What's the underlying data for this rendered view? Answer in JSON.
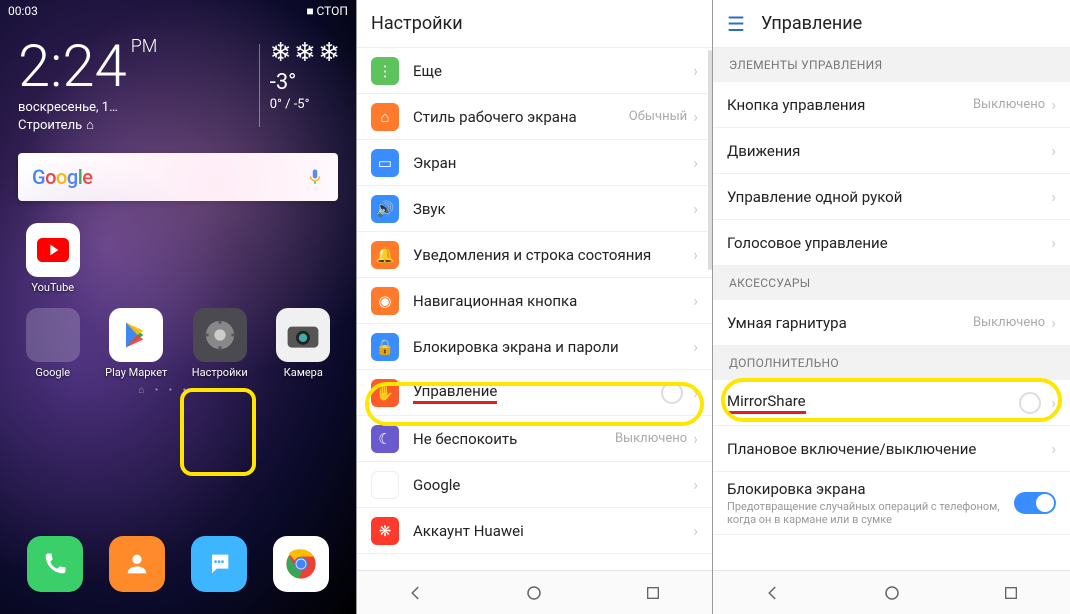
{
  "panel1": {
    "statusbar": {
      "time": "00:03",
      "stop_label": "■ СТОП"
    },
    "clock": {
      "time": "2:24",
      "pm": "PM",
      "date": "воскресенье, 1…",
      "city": "Строитель",
      "home_icon": "⌂"
    },
    "weather": {
      "snow_glyphs": "❄ ❄ ❄",
      "temp": "-3°",
      "range": "0° / -5°"
    },
    "search": {
      "logo_g1": "G",
      "logo_o1": "o",
      "logo_o2": "o",
      "logo_g2": "g",
      "logo_l": "l",
      "logo_e": "e"
    },
    "apps_row1": {
      "youtube": "YouTube"
    },
    "apps_row2": {
      "google": "Google",
      "play": "Play Маркет",
      "settings": "Настройки",
      "camera": "Камера"
    },
    "page_dots": "⌂ • • • • •"
  },
  "panel2": {
    "title": "Настройки",
    "rows": {
      "more": "Еще",
      "style": "Стиль рабочего экрана",
      "style_value": "Обычный",
      "screen": "Экран",
      "sound": "Звук",
      "notif": "Уведомления и строка состояния",
      "navkey": "Навигационная кнопка",
      "lock": "Блокировка экрана и пароли",
      "control": "Управление",
      "dnd": "Не беспокоить",
      "dnd_value": "Выключено",
      "google": "Google",
      "huawei": "Аккаунт Huawei"
    }
  },
  "panel3": {
    "title": "Управление",
    "sections": {
      "controls": "ЭЛЕМЕНТЫ УПРАВЛЕНИЯ",
      "accessories": "АКСЕССУАРЫ",
      "more": "ДОПОЛНИТЕЛЬНО"
    },
    "rows": {
      "control_button": "Кнопка управления",
      "control_button_value": "Выключено",
      "motion": "Движения",
      "onehand": "Управление одной рукой",
      "voice": "Голосовое управление",
      "smart_headset": "Умная гарнитура",
      "smart_headset_value": "Выключено",
      "mirrorshare": "MirrorShare",
      "scheduled": "Плановое включение/выключение",
      "lockscreen": "Блокировка экрана",
      "lockscreen_sub": "Предотвращение случайных операций с телефоном, когда он в кармане или в сумке"
    }
  }
}
